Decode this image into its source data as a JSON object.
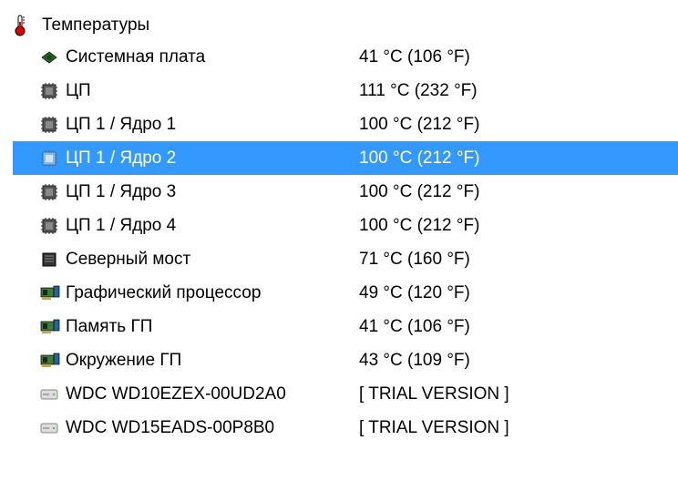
{
  "header": {
    "title": "Температуры"
  },
  "rows": [
    {
      "icon": "motherboard",
      "label": "Системная плата",
      "value": "41 °C  (106 °F)",
      "selected": false
    },
    {
      "icon": "cpu",
      "label": "ЦП",
      "value": "111 °C  (232 °F)",
      "selected": false
    },
    {
      "icon": "cpu",
      "label": "ЦП 1 / Ядро 1",
      "value": "100 °C  (212 °F)",
      "selected": false
    },
    {
      "icon": "cpu",
      "label": "ЦП 1 / Ядро 2",
      "value": "100 °C  (212 °F)",
      "selected": true
    },
    {
      "icon": "cpu",
      "label": "ЦП 1 / Ядро 3",
      "value": "100 °C  (212 °F)",
      "selected": false
    },
    {
      "icon": "cpu",
      "label": "ЦП 1 / Ядро 4",
      "value": "100 °C  (212 °F)",
      "selected": false
    },
    {
      "icon": "northbridge",
      "label": "Северный мост",
      "value": "71 °C  (160 °F)",
      "selected": false
    },
    {
      "icon": "gpu",
      "label": "Графический процессор",
      "value": "49 °C  (120 °F)",
      "selected": false
    },
    {
      "icon": "gpu",
      "label": "Память ГП",
      "value": "41 °C  (106 °F)",
      "selected": false
    },
    {
      "icon": "gpu",
      "label": "Окружение ГП",
      "value": "43 °C  (109 °F)",
      "selected": false
    },
    {
      "icon": "hdd",
      "label": "WDC WD10EZEX-00UD2A0",
      "value": "[ TRIAL VERSION ]",
      "selected": false
    },
    {
      "icon": "hdd",
      "label": "WDC WD15EADS-00P8B0",
      "value": "[ TRIAL VERSION ]",
      "selected": false
    }
  ]
}
